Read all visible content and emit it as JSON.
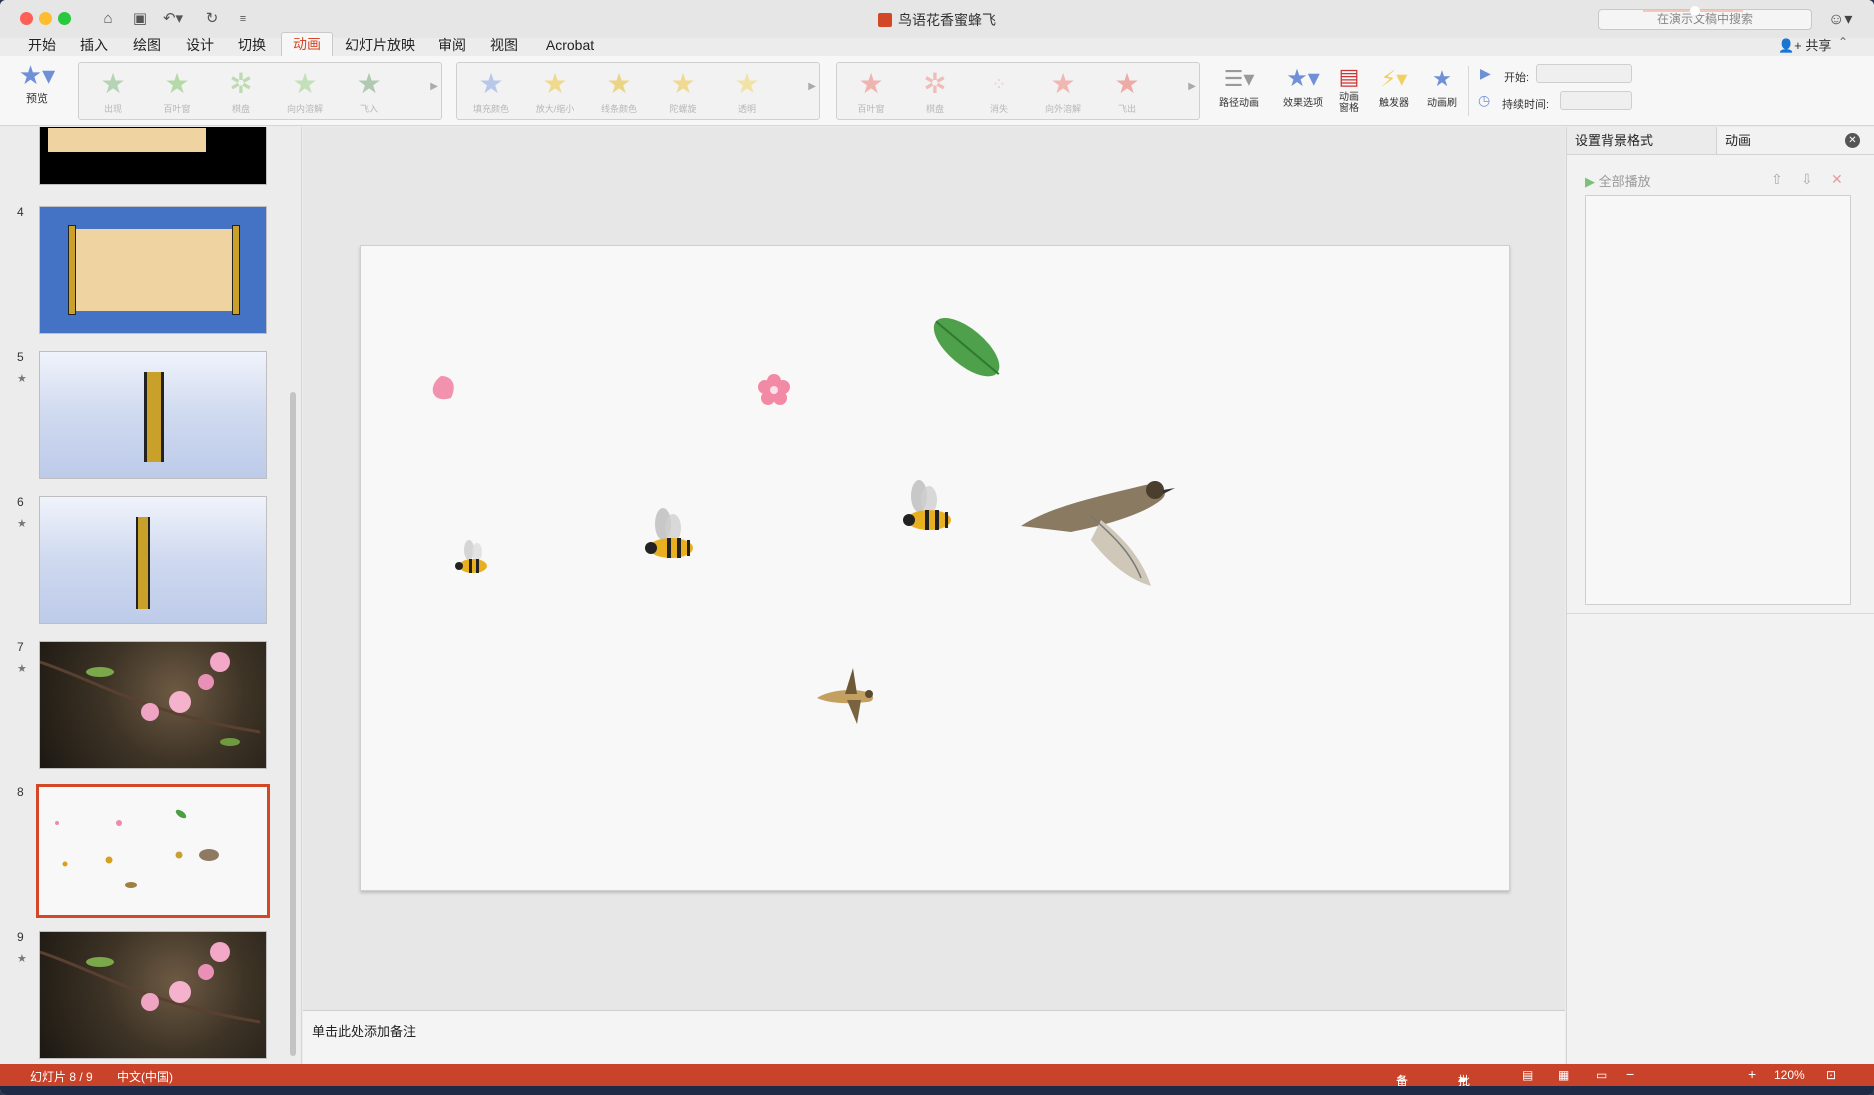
{
  "window": {
    "title": "鸟语花香蜜蜂飞",
    "search_placeholder": "在演示文稿中搜索",
    "traffic_colors": {
      "close": "#fe5f57",
      "minimize": "#febc2e",
      "zoom": "#28c840"
    }
  },
  "tabs": [
    {
      "label": "开始",
      "active": false
    },
    {
      "label": "插入",
      "active": false
    },
    {
      "label": "绘图",
      "active": false
    },
    {
      "label": "设计",
      "active": false
    },
    {
      "label": "切换",
      "active": false
    },
    {
      "label": "动画",
      "active": true
    },
    {
      "label": "幻灯片放映",
      "active": false
    },
    {
      "label": "审阅",
      "active": false
    },
    {
      "label": "视图",
      "active": false
    },
    {
      "label": "Acrobat",
      "active": false
    }
  ],
  "share_label": "共享",
  "ribbon": {
    "preview_label": "预览",
    "entrance_effects": [
      "出现",
      "百叶窗",
      "棋盘",
      "向内溶解",
      "飞入"
    ],
    "emphasis_effects": [
      "填充颜色",
      "放大/缩小",
      "线条颜色",
      "陀螺旋",
      "透明"
    ],
    "exit_effects": [
      "百叶窗",
      "棋盘",
      "消失",
      "向外溶解",
      "飞出"
    ],
    "path_animation_label": "路径动画",
    "effect_options_label": "效果选项",
    "animation_pane_label": "动画\n窗格",
    "trigger_label": "触发器",
    "animation_painter_label": "动画刷",
    "start_label": "开始:",
    "duration_label": "持续时间:",
    "accent": "#d24726"
  },
  "slides": [
    {
      "number": "4",
      "has_animation": false
    },
    {
      "number": "5",
      "has_animation": true
    },
    {
      "number": "6",
      "has_animation": true
    },
    {
      "number": "7",
      "has_animation": true
    },
    {
      "number": "8",
      "has_animation": false,
      "selected": true
    },
    {
      "number": "9",
      "has_animation": true
    }
  ],
  "notes_placeholder": "单击此处添加备注",
  "right_panel": {
    "tab_format_bg": "设置背景格式",
    "tab_animation": "动画",
    "play_all": "全部播放"
  },
  "status": {
    "slide_indicator": "幻灯片 8 / 9",
    "language": "中文(中国)",
    "notes_btn": "备注",
    "comments_btn": "批注",
    "zoom_level": "120%",
    "zoom_fraction": 0.52,
    "bar_color": "#c8432a"
  }
}
